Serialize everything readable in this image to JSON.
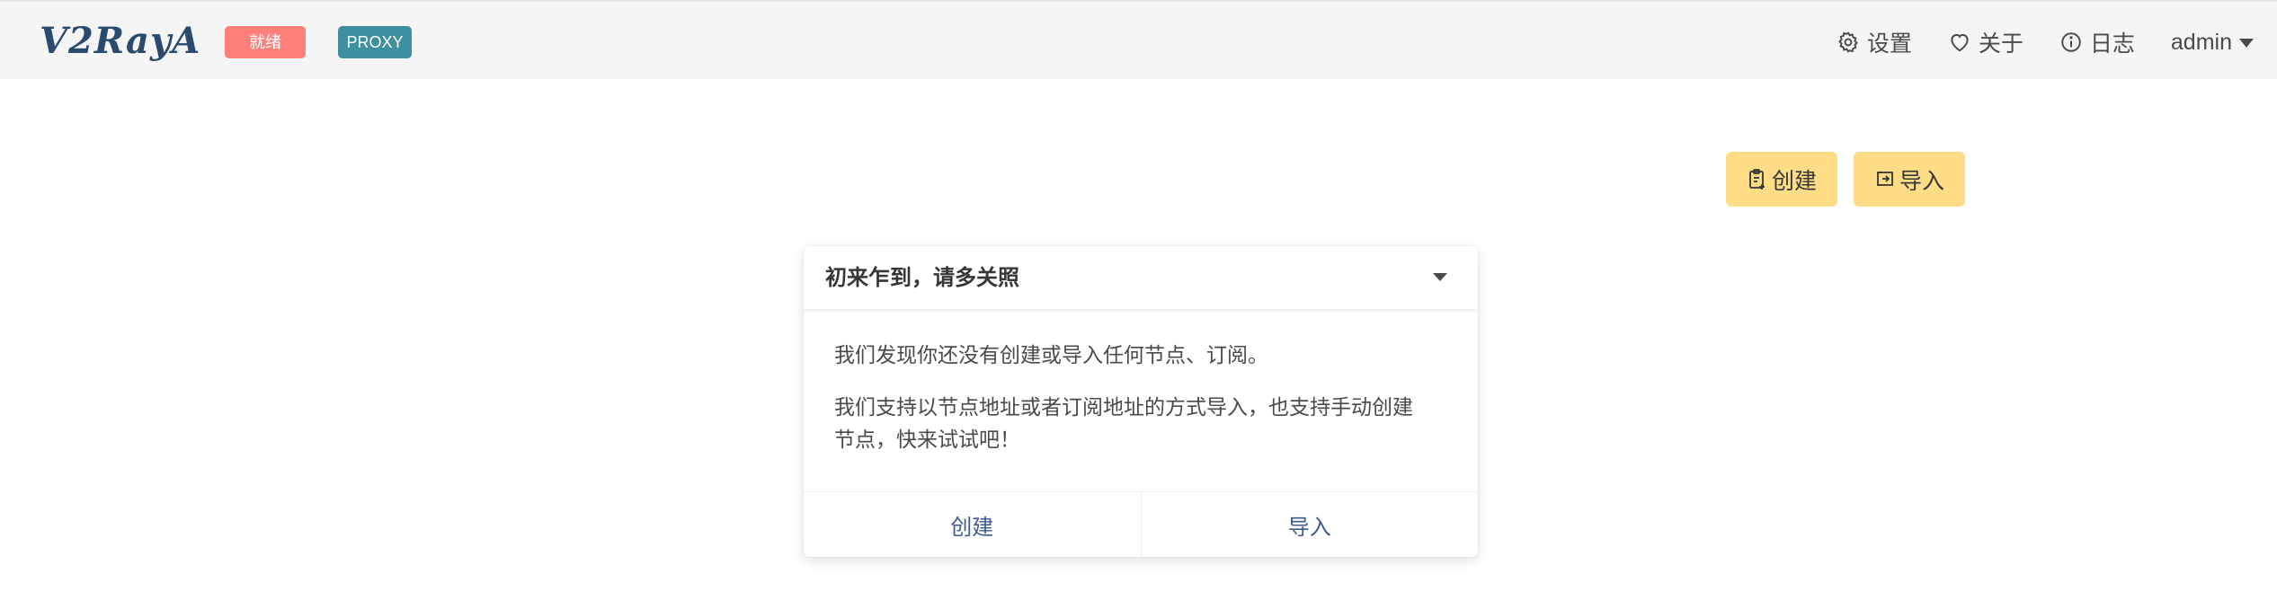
{
  "app": {
    "logo_text": "V2RayA",
    "status_tag": "就绪",
    "mode_tag": "PROXY"
  },
  "nav": {
    "settings_label": "设置",
    "about_label": "关于",
    "log_label": "日志",
    "user_label": "admin"
  },
  "toolbar": {
    "create_label": "创建",
    "import_label": "导入"
  },
  "welcome_card": {
    "title": "初来乍到，请多关照",
    "paragraph1": "我们发现你还没有创建或导入任何节点、订阅。",
    "paragraph2_line1": "我们支持以节点地址或者订阅地址的方式导入，也支持手动创建",
    "paragraph2_line2": "节点，快来试试吧！",
    "create_label": "创建",
    "import_label": "导入"
  },
  "colors": {
    "status_tag_bg": "#ff7f7b",
    "mode_tag_bg": "#3e8f9f",
    "action_button_bg": "#ffdd87",
    "link_color": "#3e5a8f",
    "navbar_bg": "#f5f5f5"
  },
  "icons": {
    "settings": "gear-icon",
    "about": "heart-icon",
    "log": "info-icon",
    "user_menu": "caret-down-icon",
    "create": "clipboard-plus-icon",
    "import": "import-arrow-icon",
    "card_toggle": "caret-down-icon"
  }
}
